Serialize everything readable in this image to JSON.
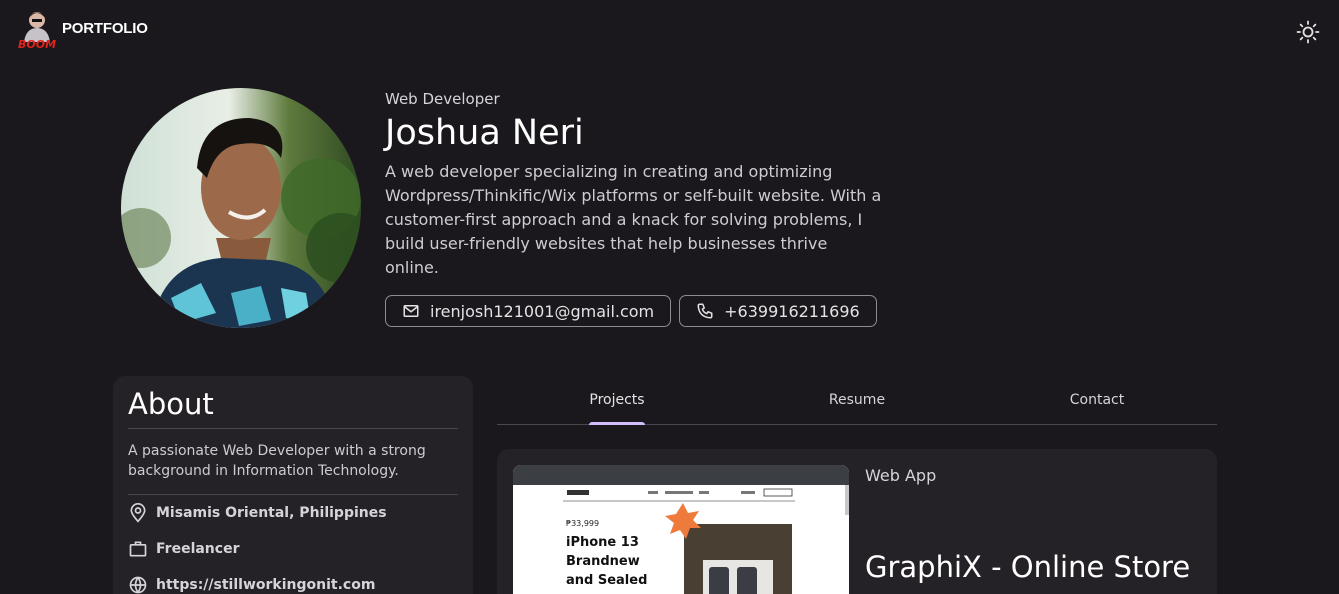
{
  "header": {
    "logo_text": "BOOM",
    "brand": "PORTFOLIO",
    "theme_icon": "sun-icon"
  },
  "profile": {
    "role": "Web Developer",
    "name": "Joshua Neri",
    "bio": "A web developer specializing in creating and optimizing Wordpress/Thinkific/Wix platforms or self-built website. With a customer-first approach and a knack for solving problems, I build user-friendly websites that help businesses thrive online.",
    "email": "irenjosh121001@gmail.com",
    "phone": "+639916211696"
  },
  "about": {
    "title": "About",
    "description": "A passionate Web Developer with a strong background in Information Technology.",
    "location": "Misamis Oriental, Philippines",
    "job": "Freelancer",
    "website": "https://stillworkingonit.com"
  },
  "tabs": [
    {
      "label": "Projects",
      "active": true
    },
    {
      "label": "Resume",
      "active": false
    },
    {
      "label": "Contact",
      "active": false
    }
  ],
  "project": {
    "category": "Web App",
    "title": "GraphiX - Online Store",
    "thumbnail": {
      "price": "₱33,999",
      "headline_line1": "iPhone 13",
      "headline_line2": "Brandnew",
      "headline_line3": "and Sealed"
    }
  },
  "colors": {
    "background": "#1a181c",
    "surface": "#242226",
    "accent": "#d0bcff",
    "logo_red": "#e0231c"
  }
}
